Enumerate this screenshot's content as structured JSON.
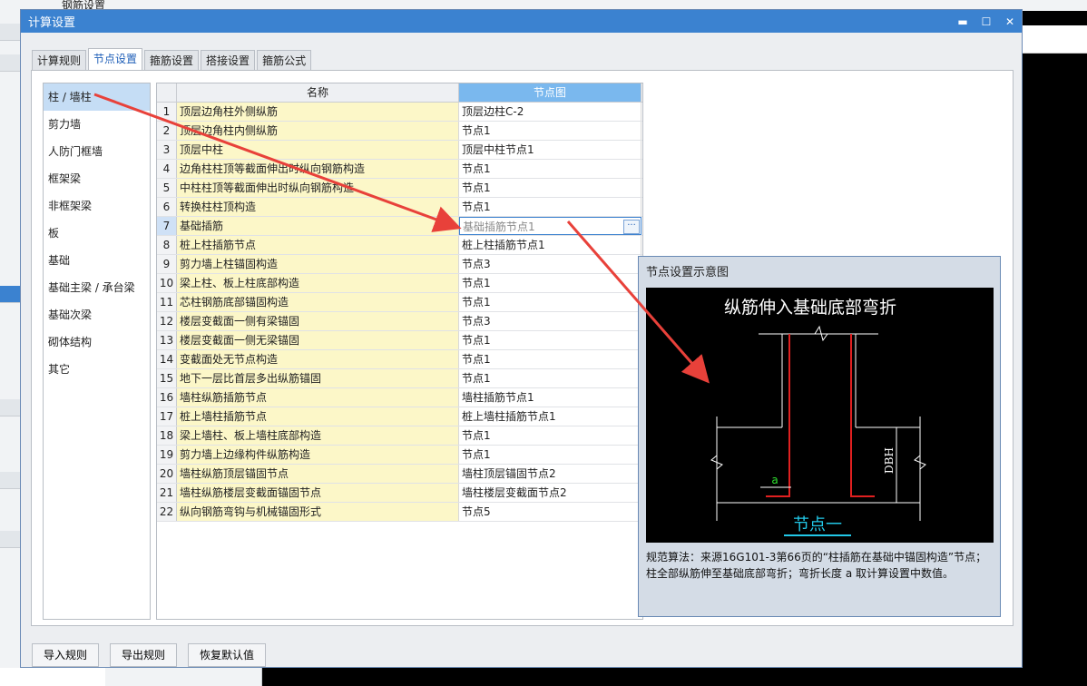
{
  "dialog": {
    "title": "计算设置",
    "minimize_glyph": "▬",
    "maximize_glyph": "☐",
    "close_glyph": "✕"
  },
  "tabs": [
    {
      "label": "计算规则",
      "active": false
    },
    {
      "label": "节点设置",
      "active": true
    },
    {
      "label": "箍筋设置",
      "active": false
    },
    {
      "label": "搭接设置",
      "active": false
    },
    {
      "label": "箍筋公式",
      "active": false
    }
  ],
  "left_list": [
    {
      "label": "柱 / 墙柱",
      "selected": true
    },
    {
      "label": "剪力墙"
    },
    {
      "label": "人防门框墙"
    },
    {
      "label": "框架梁"
    },
    {
      "label": "非框架梁"
    },
    {
      "label": "板"
    },
    {
      "label": "基础"
    },
    {
      "label": "基础主梁 / 承台梁"
    },
    {
      "label": "基础次梁"
    },
    {
      "label": "砌体结构"
    },
    {
      "label": "其它"
    }
  ],
  "grid": {
    "headers": [
      "名称",
      "节点图"
    ],
    "rows": [
      {
        "num": "1",
        "name": "顶层边角柱外侧纵筋",
        "node": "顶层边柱C-2"
      },
      {
        "num": "2",
        "name": "顶层边角柱内侧纵筋",
        "node": "节点1"
      },
      {
        "num": "3",
        "name": "顶层中柱",
        "node": "顶层中柱节点1"
      },
      {
        "num": "4",
        "name": "边角柱柱顶等截面伸出时纵向钢筋构造",
        "node": "节点1"
      },
      {
        "num": "5",
        "name": "中柱柱顶等截面伸出时纵向钢筋构造",
        "node": "节点1"
      },
      {
        "num": "6",
        "name": "转换柱柱顶构造",
        "node": "节点1"
      },
      {
        "num": "7",
        "name": "基础插筋",
        "node": "基础插筋节点1",
        "selected": true
      },
      {
        "num": "8",
        "name": "桩上柱插筋节点",
        "node": "桩上柱插筋节点1"
      },
      {
        "num": "9",
        "name": "剪力墙上柱锚固构造",
        "node": "节点3"
      },
      {
        "num": "10",
        "name": "梁上柱、板上柱底部构造",
        "node": "节点1"
      },
      {
        "num": "11",
        "name": "芯柱钢筋底部锚固构造",
        "node": "节点1"
      },
      {
        "num": "12",
        "name": "楼层变截面一侧有梁锚固",
        "node": "节点3"
      },
      {
        "num": "13",
        "name": "楼层变截面一侧无梁锚固",
        "node": "节点1"
      },
      {
        "num": "14",
        "name": "变截面处无节点构造",
        "node": "节点1"
      },
      {
        "num": "15",
        "name": "地下一层比首层多出纵筋锚固",
        "node": "节点1"
      },
      {
        "num": "16",
        "name": "墙柱纵筋插筋节点",
        "node": "墙柱插筋节点1"
      },
      {
        "num": "17",
        "name": "桩上墙柱插筋节点",
        "node": "桩上墙柱插筋节点1"
      },
      {
        "num": "18",
        "name": "梁上墙柱、板上墙柱底部构造",
        "node": "节点1"
      },
      {
        "num": "19",
        "name": "剪力墙上边缘构件纵筋构造",
        "node": "节点1"
      },
      {
        "num": "20",
        "name": "墙柱纵筋顶层锚固节点",
        "node": "墙柱顶层锚固节点2"
      },
      {
        "num": "21",
        "name": "墙柱纵筋楼层变截面锚固节点",
        "node": "墙柱楼层变截面节点2"
      },
      {
        "num": "22",
        "name": "纵向钢筋弯钩与机械锚固形式",
        "node": "节点5"
      }
    ],
    "ellipsis_glyph": "···"
  },
  "panel": {
    "title": "节点设置示意图",
    "diagram_title": "纵筋伸入基础底部弯折",
    "dim_label": "DBH",
    "a_label": "a",
    "node_label": "节点一",
    "description_1": "规范算法：来源16G101-3第66页的“柱插筋在基础中锚固构造”节点；",
    "description_2": "柱全部纵筋伸至基础底部弯折；弯折长度 a 取计算设置中数值。"
  },
  "buttons": {
    "import": "导入规则",
    "export": "导出规则",
    "restore": "恢复默认值"
  },
  "background": {
    "peek_text": "钢筋设置"
  },
  "colors": {
    "title_bar": "#3b82d0",
    "selected_blue": "#c5ddf5",
    "name_cell": "#fcf7c8",
    "rebar_red": "#e02020",
    "annotation_arrow": "#e8413a"
  }
}
